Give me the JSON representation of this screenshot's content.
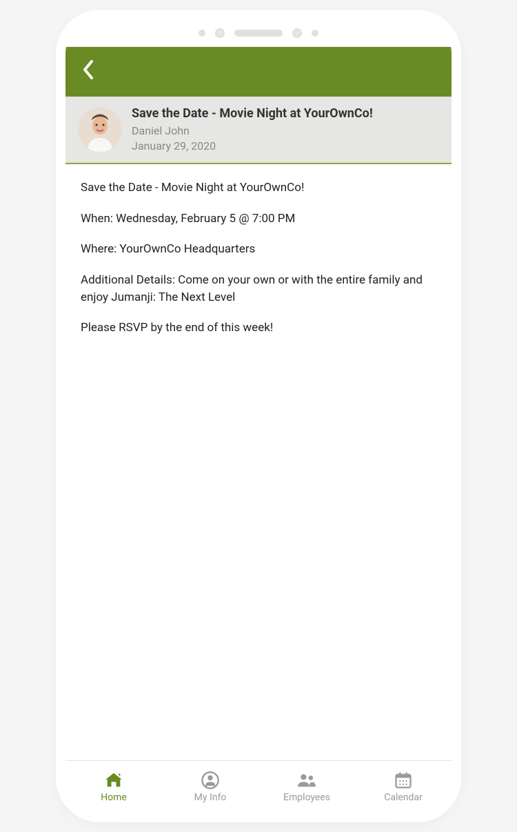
{
  "colors": {
    "brand": "#6a8a24",
    "muted": "#9a9a9a"
  },
  "post": {
    "title": "Save the Date - Movie Night at YourOwnCo!",
    "author": "Daniel John",
    "date": "January 29, 2020",
    "body": {
      "line1": "Save the Date - Movie Night at YourOwnCo!",
      "line2": "When: Wednesday, February 5 @ 7:00 PM",
      "line3": "Where: YourOwnCo Headquarters",
      "line4": "Additional Details: Come on your own or with the entire family and enjoy Jumanji: The Next Level",
      "line5": "Please RSVP by the end of this week!"
    }
  },
  "nav": {
    "items": [
      {
        "label": "Home",
        "icon": "home-icon",
        "active": true
      },
      {
        "label": "My Info",
        "icon": "person-icon",
        "active": false
      },
      {
        "label": "Employees",
        "icon": "people-icon",
        "active": false
      },
      {
        "label": "Calendar",
        "icon": "calendar-icon",
        "active": false
      }
    ]
  }
}
